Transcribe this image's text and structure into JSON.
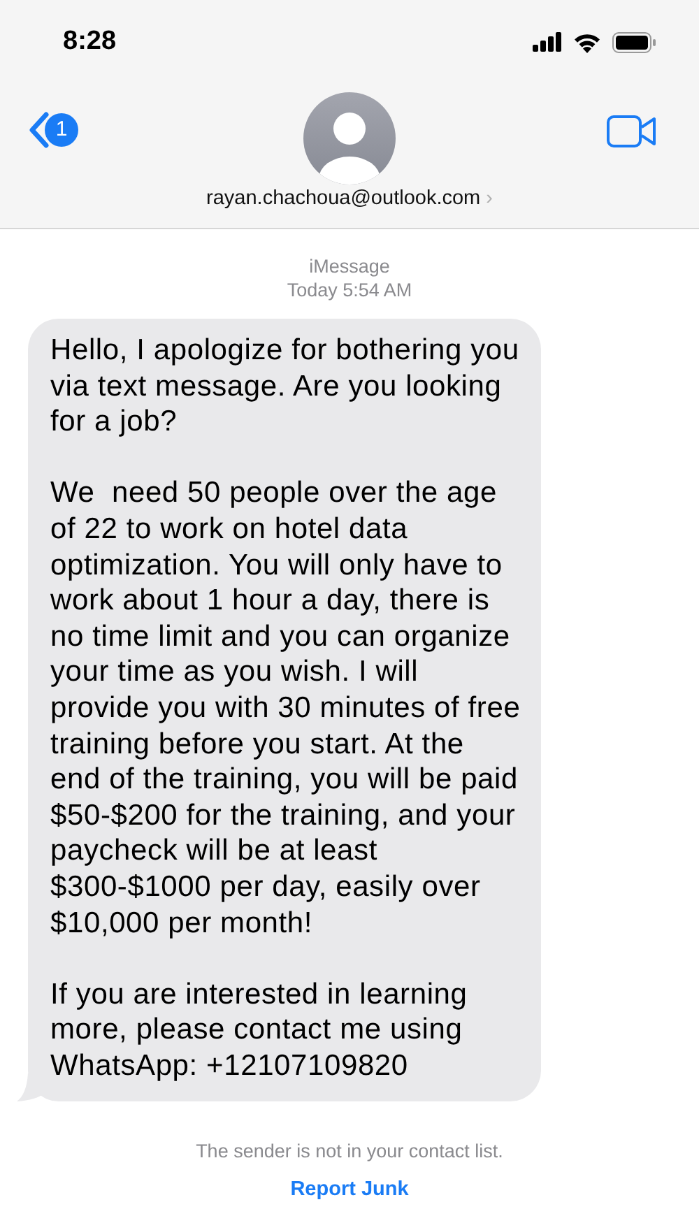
{
  "status_bar": {
    "time": "8:28"
  },
  "header": {
    "back_badge": "1",
    "contact": "rayan.chachoua@outlook.com",
    "chevron": "›"
  },
  "thread": {
    "service": "iMessage",
    "timestamp": "Today 5:54 AM"
  },
  "message": {
    "paragraphs": [
      "Hello, I apologize for bothering you via text message. Are you looking for a job?",
      "We  need 50 people over the age of 22 to work on hotel data optimization. You will only have to work about 1 hour a day, there is no time limit and you can organize your time as you wish. I will provide you with 30 minutes of free training before you start. At the end of the training, you will be paid $50-$200 for the training, and your paycheck will be at least $300-$1000 per day, easily over $10,000 per month!",
      "If you are interested in learning more, please contact me using WhatsApp: +12107109820"
    ]
  },
  "footer": {
    "notice": "The sender is not in your contact list.",
    "report_link": "Report Junk"
  }
}
